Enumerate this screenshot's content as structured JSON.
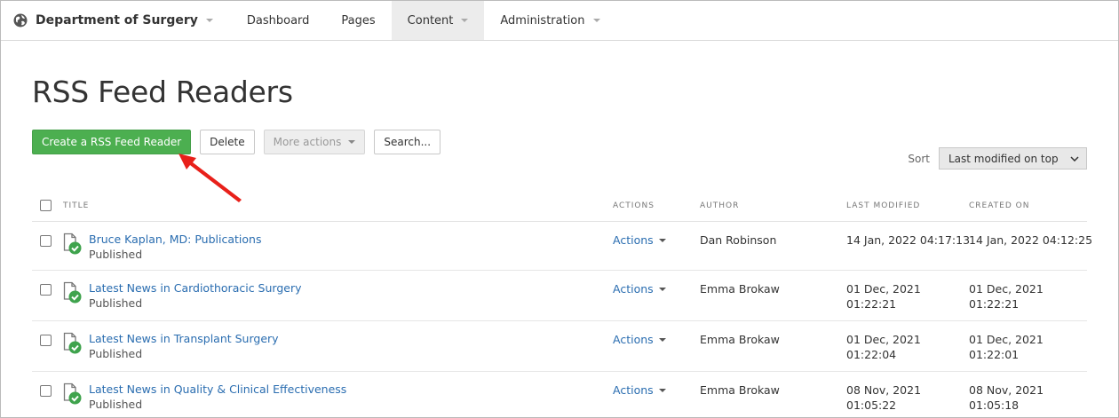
{
  "nav": {
    "brand": "Department of Surgery",
    "items": [
      {
        "label": "Dashboard",
        "has_caret": false,
        "active": false
      },
      {
        "label": "Pages",
        "has_caret": false,
        "active": false
      },
      {
        "label": "Content",
        "has_caret": true,
        "active": true
      },
      {
        "label": "Administration",
        "has_caret": true,
        "active": false
      }
    ]
  },
  "page": {
    "title": "RSS Feed Readers"
  },
  "toolbar": {
    "create_label": "Create a RSS Feed Reader",
    "delete_label": "Delete",
    "more_label": "More actions",
    "search_label": "Search..."
  },
  "sort": {
    "label": "Sort",
    "value": "Last modified on top"
  },
  "table": {
    "headers": {
      "title": "TITLE",
      "actions": "ACTIONS",
      "author": "AUTHOR",
      "modified": "LAST MODIFIED",
      "created": "CREATED ON"
    },
    "rows": [
      {
        "title": "Bruce Kaplan, MD: Publications",
        "status": "Published",
        "actions": "Actions",
        "author": "Dan Robinson",
        "modified_1": "14 Jan, 2022 04:17:13",
        "modified_2": "",
        "created_1": "14 Jan, 2022 04:12:25",
        "created_2": ""
      },
      {
        "title": "Latest News in Cardiothoracic Surgery",
        "status": "Published",
        "actions": "Actions",
        "author": "Emma Brokaw",
        "modified_1": "01 Dec, 2021",
        "modified_2": "01:22:21",
        "created_1": "01 Dec, 2021",
        "created_2": "01:22:21"
      },
      {
        "title": "Latest News in Transplant Surgery",
        "status": "Published",
        "actions": "Actions",
        "author": "Emma Brokaw",
        "modified_1": "01 Dec, 2021",
        "modified_2": "01:22:04",
        "created_1": "01 Dec, 2021",
        "created_2": "01:22:01"
      },
      {
        "title": "Latest News in Quality & Clinical Effectiveness",
        "status": "Published",
        "actions": "Actions",
        "author": "Emma Brokaw",
        "modified_1": "08 Nov, 2021",
        "modified_2": "01:05:22",
        "created_1": "08 Nov, 2021",
        "created_2": "01:05:18"
      }
    ]
  },
  "colors": {
    "primary": "#4caf50",
    "link": "#2a6db0",
    "annotation_arrow": "#e8201a"
  },
  "icons": {
    "brand": "globe-icon",
    "row": "published-document-icon"
  }
}
